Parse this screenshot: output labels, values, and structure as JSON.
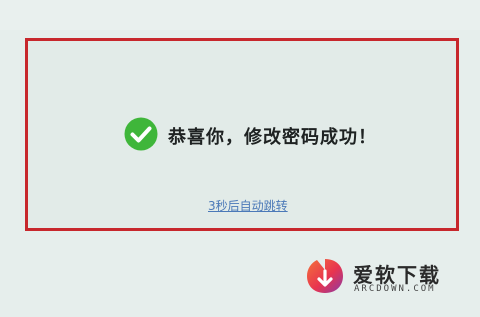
{
  "notice": {
    "message": "恭喜你，修改密码成功！",
    "redirect_link": "3秒后自动跳转",
    "icon": "check-circle-icon",
    "border_color": "#c7272c",
    "icon_color": "#3fb63a",
    "link_color": "#4b79b8"
  },
  "watermark": {
    "title": "爱软下载",
    "subtitle": "ARCDOWN.COM",
    "logo": "arcdown-logo",
    "logo_colors": [
      "#e8344f",
      "#f4723a",
      "#8b3ba6"
    ]
  }
}
